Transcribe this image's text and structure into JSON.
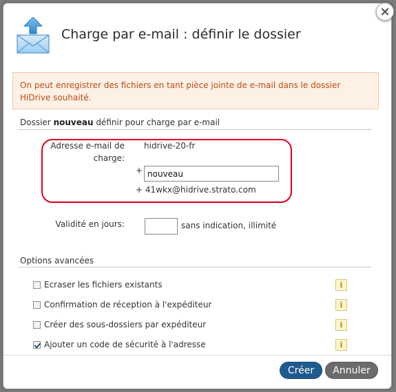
{
  "dialog": {
    "title": "Charge par e-mail : définir le dossier",
    "info_text": "On peut enregistrer des fichiers en tant pièce jointe de e-mail dans le dossier HiDrive souhaité.",
    "close_icon": "close-icon",
    "header_icon": "upload-envelope-icon"
  },
  "folder_section": {
    "title_prefix": "Dossier ",
    "title_bold": "nouveau",
    "title_suffix": " définir pour charge par e-mail",
    "email_label": "Adresse e-mail de charge:",
    "email_prefix": "hidrive-20-fr",
    "plus_sign": "+",
    "folder_input_value": "nouveau",
    "email_suffix": "+ 41wkx@hidrive.strato.com",
    "validity_label": "Validité en jours:",
    "validity_value": "",
    "validity_hint": "sans indication, illimité"
  },
  "advanced": {
    "title": "Options avancées",
    "options": [
      {
        "label": "Ecraser les fichiers existants",
        "checked": false
      },
      {
        "label": "Confirmation de réception à l'expéditeur",
        "checked": false
      },
      {
        "label": "Créer des sous-dossiers par expéditeur",
        "checked": false
      },
      {
        "label": "Ajouter un code de sécurité à l'adresse",
        "checked": true
      }
    ],
    "info_glyph": "i"
  },
  "footer": {
    "create_label": "Créer",
    "cancel_label": "Annuler"
  },
  "colors": {
    "primary_button": "#1f5a8f",
    "secondary_button": "#6b6b6b",
    "highlight": "#e1001a",
    "info_text": "#c04a10"
  }
}
